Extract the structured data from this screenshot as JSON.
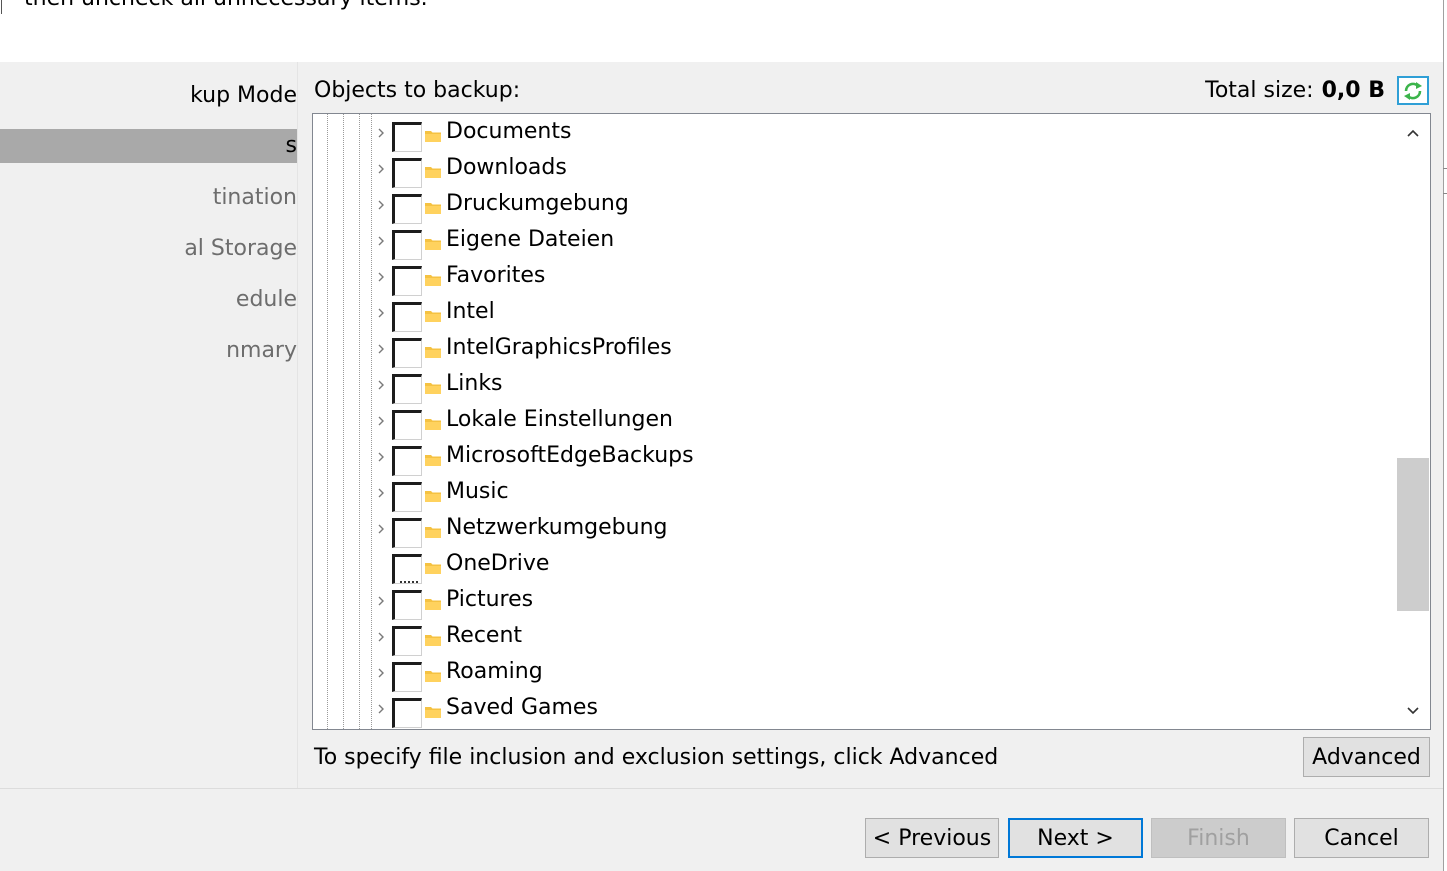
{
  "header": {
    "instruction_text": "then uncheck all unnecessary items."
  },
  "sidebar": {
    "steps": [
      {
        "label": "kup Mode",
        "state": "visited"
      },
      {
        "label": "s",
        "state": "active"
      },
      {
        "label": "tination",
        "state": "pending"
      },
      {
        "label": "al Storage",
        "state": "pending"
      },
      {
        "label": "edule",
        "state": "pending"
      },
      {
        "label": "nmary",
        "state": "pending"
      }
    ]
  },
  "objects": {
    "label": "Objects to backup:",
    "total_size_label": "Total size:",
    "total_size_value": "0,0 B",
    "refresh_icon": "refresh-icon"
  },
  "tree": {
    "items": [
      {
        "label": "Documents",
        "checked": false,
        "expandable": true
      },
      {
        "label": "Downloads",
        "checked": false,
        "expandable": true
      },
      {
        "label": "Druckumgebung",
        "checked": false,
        "expandable": true
      },
      {
        "label": "Eigene Dateien",
        "checked": false,
        "expandable": true
      },
      {
        "label": "Favorites",
        "checked": false,
        "expandable": true
      },
      {
        "label": "Intel",
        "checked": false,
        "expandable": true
      },
      {
        "label": "IntelGraphicsProfiles",
        "checked": false,
        "expandable": true
      },
      {
        "label": "Links",
        "checked": false,
        "expandable": true
      },
      {
        "label": "Lokale Einstellungen",
        "checked": false,
        "expandable": true
      },
      {
        "label": "MicrosoftEdgeBackups",
        "checked": false,
        "expandable": true
      },
      {
        "label": "Music",
        "checked": false,
        "expandable": true
      },
      {
        "label": "Netzwerkumgebung",
        "checked": false,
        "expandable": true
      },
      {
        "label": "OneDrive",
        "checked": "partial",
        "expandable": false
      },
      {
        "label": "Pictures",
        "checked": false,
        "expandable": true
      },
      {
        "label": "Recent",
        "checked": false,
        "expandable": true
      },
      {
        "label": "Roaming",
        "checked": false,
        "expandable": true
      },
      {
        "label": "Saved Games",
        "checked": false,
        "expandable": true
      }
    ]
  },
  "hint": {
    "text": "To specify file inclusion and exclusion settings, click Advanced"
  },
  "buttons": {
    "advanced": "Advanced",
    "previous": "< Previous",
    "next": "Next >",
    "finish": "Finish",
    "cancel": "Cancel"
  },
  "colors": {
    "accent": "#0078d7",
    "refresh_border": "#2f9fd6",
    "refresh_arrows": "#3cb44b",
    "folder": "#f5c242",
    "active_step_bg": "#a9a9a9"
  }
}
